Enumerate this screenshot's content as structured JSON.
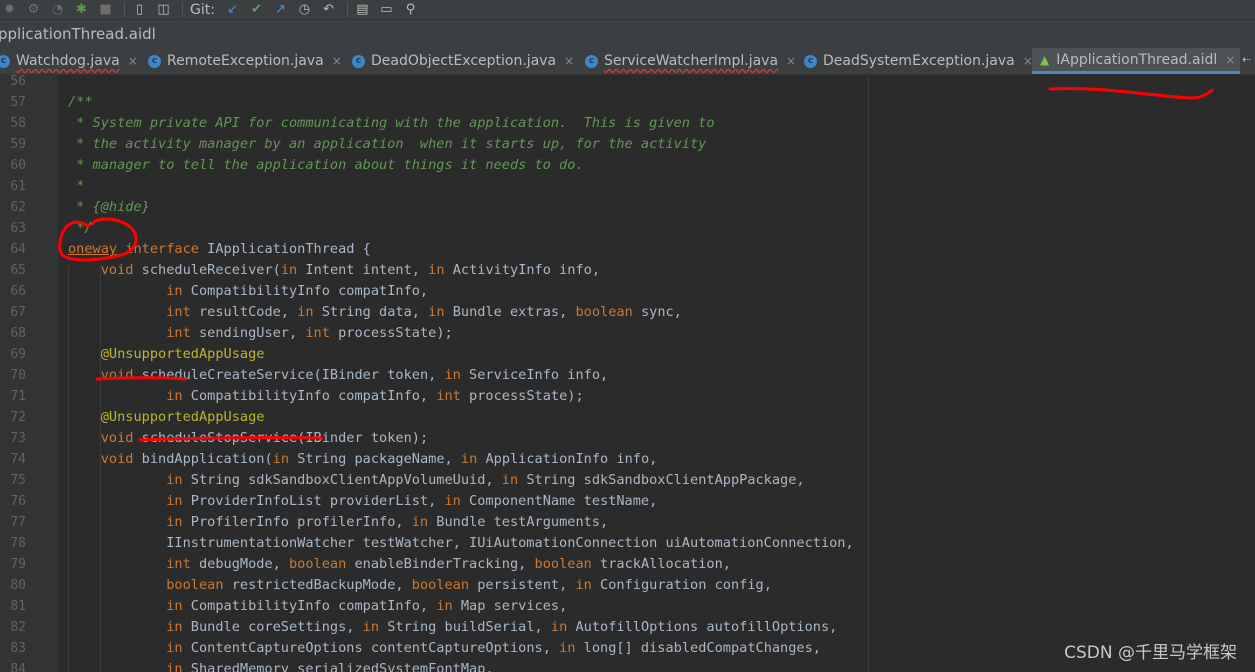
{
  "toolbar": {
    "git_label": "Git:",
    "icons": [
      "bug-icon",
      "profiler-icon",
      "gauge-icon",
      "android-run-icon",
      "stop-icon",
      "device-file-icon",
      "deploy-icon",
      "update-icon",
      "commit-icon",
      "push-icon",
      "fetch-icon",
      "history-icon",
      "rollback-icon",
      "project-structure-icon",
      "layout-icon",
      "search-icon"
    ]
  },
  "window": {
    "title": "pplicationThread.aidl"
  },
  "tabs": [
    {
      "label": "Watchdog.java",
      "icon": "class-icon",
      "active": false
    },
    {
      "label": "RemoteException.java",
      "icon": "class-icon",
      "active": false
    },
    {
      "label": "DeadObjectException.java",
      "icon": "class-icon",
      "active": false
    },
    {
      "label": "ServiceWatcherImpl.java",
      "icon": "class-icon",
      "active": false
    },
    {
      "label": "DeadSystemException.java",
      "icon": "class-icon",
      "active": false
    },
    {
      "label": "IApplicationThread.aidl",
      "icon": "android-icon",
      "active": true
    }
  ],
  "tab_close_glyph": "×",
  "tab_more_glyph": "⇠",
  "editor": {
    "lines": [
      {
        "n": "56",
        "tokens": []
      },
      {
        "n": "57",
        "tokens": [
          [
            "cm",
            "/**"
          ]
        ]
      },
      {
        "n": "58",
        "tokens": [
          [
            "cm",
            " * System private API for communicating with the application.  This is given to"
          ]
        ]
      },
      {
        "n": "59",
        "tokens": [
          [
            "cm",
            " * the activity manager by an application  when it starts up, for the activity"
          ]
        ]
      },
      {
        "n": "60",
        "tokens": [
          [
            "cm",
            " * manager to tell the application about things it needs to do."
          ]
        ]
      },
      {
        "n": "61",
        "tokens": [
          [
            "cm",
            " *"
          ]
        ]
      },
      {
        "n": "62",
        "tokens": [
          [
            "cm",
            " * {@hide}"
          ]
        ]
      },
      {
        "n": "63",
        "tokens": [
          [
            "cm",
            " */"
          ]
        ]
      },
      {
        "n": "64",
        "tokens": [
          [
            "kw ul",
            "oneway"
          ],
          [
            "pl",
            " "
          ],
          [
            "kw",
            "interface"
          ],
          [
            "pl",
            " IApplicationThread {"
          ]
        ]
      },
      {
        "n": "65",
        "tokens": [
          [
            "pl",
            "    "
          ],
          [
            "kw",
            "void"
          ],
          [
            "pl",
            " scheduleReceiver("
          ],
          [
            "kw",
            "in"
          ],
          [
            "pl",
            " Intent intent, "
          ],
          [
            "kw",
            "in"
          ],
          [
            "pl",
            " ActivityInfo info,"
          ]
        ]
      },
      {
        "n": "66",
        "tokens": [
          [
            "pl",
            "            "
          ],
          [
            "kw",
            "in"
          ],
          [
            "pl",
            " CompatibilityInfo compatInfo,"
          ]
        ]
      },
      {
        "n": "67",
        "tokens": [
          [
            "pl",
            "            "
          ],
          [
            "kw",
            "int"
          ],
          [
            "pl",
            " resultCode, "
          ],
          [
            "kw",
            "in"
          ],
          [
            "pl",
            " String data, "
          ],
          [
            "kw",
            "in"
          ],
          [
            "pl",
            " Bundle extras, "
          ],
          [
            "kw",
            "boolean"
          ],
          [
            "pl",
            " sync,"
          ]
        ]
      },
      {
        "n": "68",
        "tokens": [
          [
            "pl",
            "            "
          ],
          [
            "kw",
            "int"
          ],
          [
            "pl",
            " sendingUser, "
          ],
          [
            "kw",
            "int"
          ],
          [
            "pl",
            " processState);"
          ]
        ]
      },
      {
        "n": "69",
        "tokens": [
          [
            "pl",
            "    "
          ],
          [
            "ann",
            "@UnsupportedAppUsage"
          ]
        ]
      },
      {
        "n": "70",
        "tokens": [
          [
            "pl",
            "    "
          ],
          [
            "kw",
            "void"
          ],
          [
            "pl",
            " scheduleCreateService(IBinder token, "
          ],
          [
            "kw",
            "in"
          ],
          [
            "pl",
            " ServiceInfo info,"
          ]
        ]
      },
      {
        "n": "71",
        "tokens": [
          [
            "pl",
            "            "
          ],
          [
            "kw",
            "in"
          ],
          [
            "pl",
            " CompatibilityInfo compatInfo, "
          ],
          [
            "kw",
            "int"
          ],
          [
            "pl",
            " processState);"
          ]
        ]
      },
      {
        "n": "72",
        "tokens": [
          [
            "pl",
            "    "
          ],
          [
            "ann",
            "@UnsupportedAppUsage"
          ]
        ]
      },
      {
        "n": "73",
        "tokens": [
          [
            "pl",
            "    "
          ],
          [
            "kw",
            "void"
          ],
          [
            "pl",
            " scheduleStopService(IBinder token);"
          ]
        ]
      },
      {
        "n": "74",
        "tokens": [
          [
            "pl",
            "    "
          ],
          [
            "kw",
            "void"
          ],
          [
            "pl",
            " bindApplication("
          ],
          [
            "kw",
            "in"
          ],
          [
            "pl",
            " String packageName, "
          ],
          [
            "kw",
            "in"
          ],
          [
            "pl",
            " ApplicationInfo info,"
          ]
        ]
      },
      {
        "n": "75",
        "tokens": [
          [
            "pl",
            "            "
          ],
          [
            "kw",
            "in"
          ],
          [
            "pl",
            " String sdkSandboxClientAppVolumeUuid, "
          ],
          [
            "kw",
            "in"
          ],
          [
            "pl",
            " String sdkSandboxClientAppPackage,"
          ]
        ]
      },
      {
        "n": "76",
        "tokens": [
          [
            "pl",
            "            "
          ],
          [
            "kw",
            "in"
          ],
          [
            "pl",
            " ProviderInfoList providerList, "
          ],
          [
            "kw",
            "in"
          ],
          [
            "pl",
            " ComponentName testName,"
          ]
        ]
      },
      {
        "n": "77",
        "tokens": [
          [
            "pl",
            "            "
          ],
          [
            "kw",
            "in"
          ],
          [
            "pl",
            " ProfilerInfo profilerInfo, "
          ],
          [
            "kw",
            "in"
          ],
          [
            "pl",
            " Bundle testArguments,"
          ]
        ]
      },
      {
        "n": "78",
        "tokens": [
          [
            "pl",
            "            IInstrumentationWatcher testWatcher, IUiAutomationConnection uiAutomationConnection,"
          ]
        ]
      },
      {
        "n": "79",
        "tokens": [
          [
            "pl",
            "            "
          ],
          [
            "kw",
            "int"
          ],
          [
            "pl",
            " debugMode, "
          ],
          [
            "kw",
            "boolean"
          ],
          [
            "pl",
            " enableBinderTracking, "
          ],
          [
            "kw",
            "boolean"
          ],
          [
            "pl",
            " trackAllocation,"
          ]
        ]
      },
      {
        "n": "80",
        "tokens": [
          [
            "pl",
            "            "
          ],
          [
            "kw",
            "boolean"
          ],
          [
            "pl",
            " restrictedBackupMode, "
          ],
          [
            "kw",
            "boolean"
          ],
          [
            "pl",
            " persistent, "
          ],
          [
            "kw",
            "in"
          ],
          [
            "pl",
            " Configuration config,"
          ]
        ]
      },
      {
        "n": "81",
        "tokens": [
          [
            "pl",
            "            "
          ],
          [
            "kw",
            "in"
          ],
          [
            "pl",
            " CompatibilityInfo compatInfo, "
          ],
          [
            "kw",
            "in"
          ],
          [
            "pl",
            " Map services,"
          ]
        ]
      },
      {
        "n": "82",
        "tokens": [
          [
            "pl",
            "            "
          ],
          [
            "kw",
            "in"
          ],
          [
            "pl",
            " Bundle coreSettings, "
          ],
          [
            "kw",
            "in"
          ],
          [
            "pl",
            " String buildSerial, "
          ],
          [
            "kw",
            "in"
          ],
          [
            "pl",
            " AutofillOptions autofillOptions,"
          ]
        ]
      },
      {
        "n": "83",
        "tokens": [
          [
            "pl",
            "            "
          ],
          [
            "kw",
            "in"
          ],
          [
            "pl",
            " ContentCaptureOptions contentCaptureOptions, "
          ],
          [
            "kw",
            "in"
          ],
          [
            "pl",
            " long[] disabledCompatChanges,"
          ]
        ]
      },
      {
        "n": "84",
        "tokens": [
          [
            "pl",
            "            "
          ],
          [
            "kw",
            "in"
          ],
          [
            "pl",
            " SharedMemory serializedSystemFontMap,"
          ]
        ]
      }
    ]
  },
  "watermark": "CSDN @千里马学框架",
  "colors": {
    "comment": "#629755",
    "keyword": "#cc7832",
    "annotation": "#bbb529",
    "plain": "#a9b7c6",
    "line_number": "#606366",
    "markup_red": "#ff0000"
  }
}
